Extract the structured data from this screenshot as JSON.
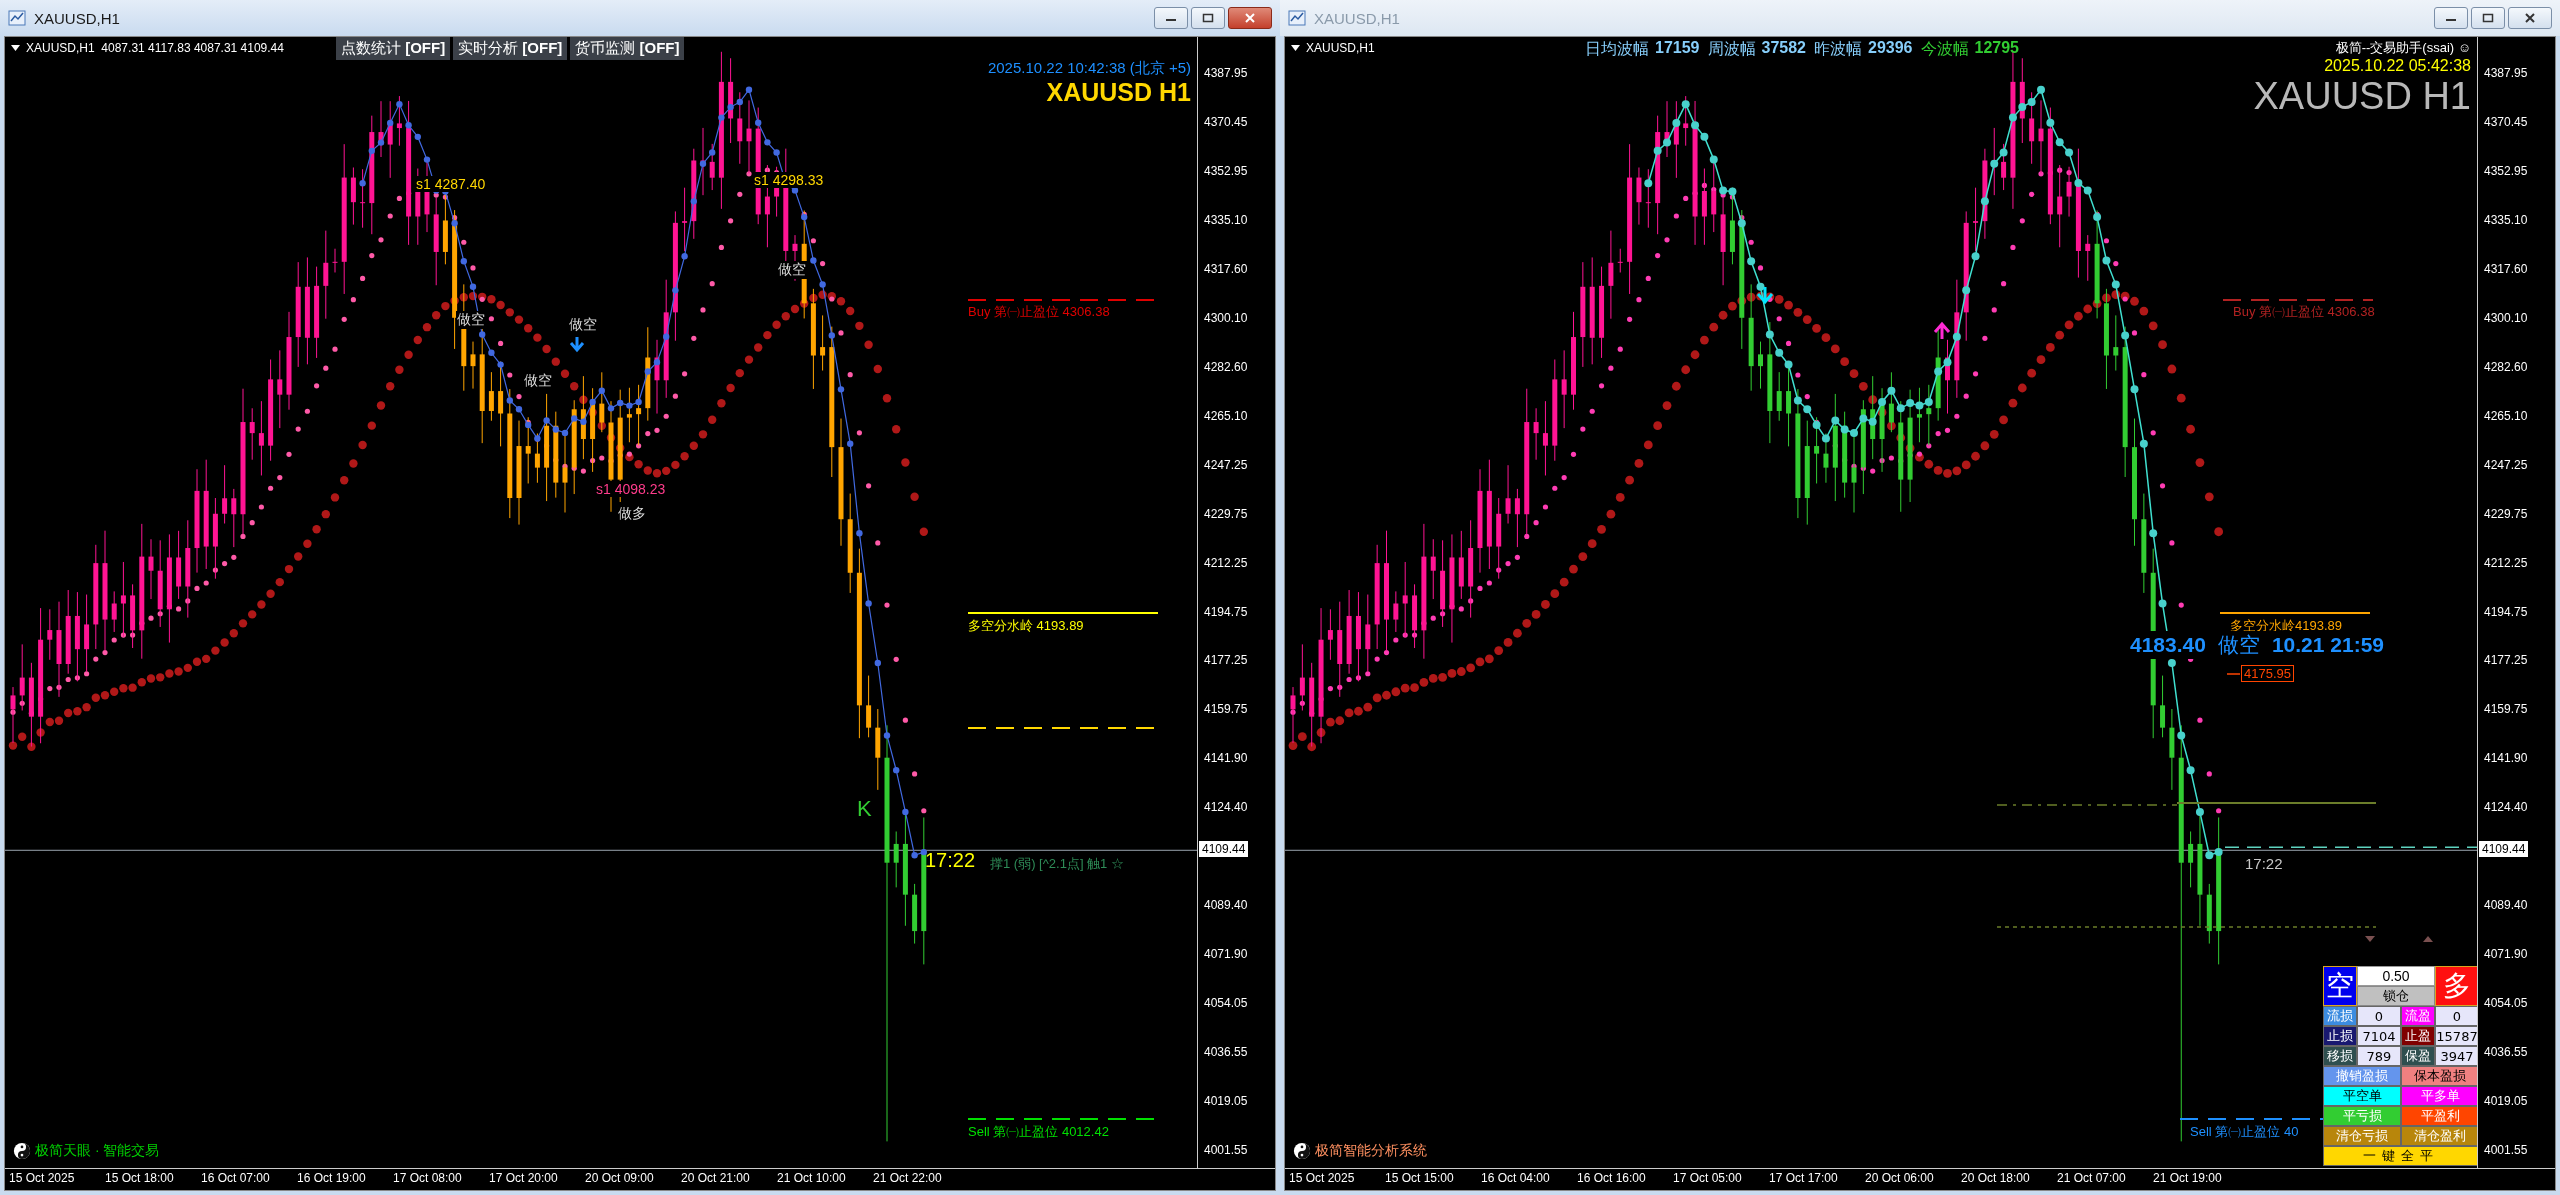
{
  "left_chart": {
    "title": "XAUUSD,H1",
    "active": true,
    "header": "XAUUSD,H1  4087.31 4117.83 4087.31 4109.44",
    "toggles": [
      {
        "label": "点数统计",
        "state": "[OFF]"
      },
      {
        "label": "实时分析",
        "state": "[OFF]"
      },
      {
        "label": "货币监测",
        "state": "[OFF]"
      }
    ],
    "datetime": "2025.10.22 10:42:38 (北京 +5)",
    "symbol": "XAUUSD H1",
    "annotations": [
      {
        "text": "s1 4287.40",
        "color": "#ffd700"
      },
      {
        "text": "s1 4298.33",
        "color": "#ffd700"
      },
      {
        "text": "做空",
        "color": "#dcdcdc"
      },
      {
        "text": "做空",
        "color": "#dcdcdc"
      },
      {
        "text": "做空",
        "color": "#dcdcdc"
      },
      {
        "text": "做空",
        "color": "#dcdcdc"
      },
      {
        "text": "s1 4098.23",
        "color": "#ff3c8c"
      },
      {
        "text": "做多",
        "color": "#dcdcdc"
      },
      {
        "text": "K",
        "color": "#32cd32"
      }
    ],
    "levels": [
      {
        "text": "Buy 第㈠止盈位 4306.38",
        "color": "#e00000"
      },
      {
        "text": "多空分水岭 4193.89",
        "color": "#ffff00"
      },
      {
        "text": "Sell 第㈠止盈位 4012.42",
        "color": "#00e000"
      }
    ],
    "countdown": "17:22",
    "signal": "撑1 (弱) [^2.1点] 触1 ☆",
    "brand": "极简天眼 · 智能交易",
    "current_price": "4109.44",
    "price_labels": [
      "4387.95",
      "4370.45",
      "4352.95",
      "4335.10",
      "4317.60",
      "4300.10",
      "4282.60",
      "4265.10",
      "4247.25",
      "4229.75",
      "4212.25",
      "4194.75",
      "4177.25",
      "4159.75",
      "4141.90",
      "4124.40",
      "4089.40",
      "4071.90",
      "4054.05",
      "4036.55",
      "4019.05",
      "4001.55"
    ],
    "time_labels": [
      "15 Oct 2025",
      "15 Oct 18:00",
      "16 Oct 07:00",
      "16 Oct 19:00",
      "17 Oct 08:00",
      "17 Oct 20:00",
      "20 Oct 09:00",
      "20 Oct 21:00",
      "21 Oct 10:00",
      "21 Oct 22:00"
    ]
  },
  "right_chart": {
    "title": "XAUUSD,H1",
    "active": false,
    "header": "XAUUSD,H1",
    "stats": [
      {
        "label": "日均波幅",
        "value": "17159",
        "color": "#87cefa"
      },
      {
        "label": "周波幅",
        "value": "37582",
        "color": "#87cefa"
      },
      {
        "label": "昨波幅",
        "value": "29396",
        "color": "#87cefa"
      },
      {
        "label": "今波幅",
        "value": "12795",
        "color": "#32cd32"
      }
    ],
    "assistant": "极简--交易助手(ssai) ☺",
    "datetime": "2025.10.22 05:42:38",
    "symbol": "XAUUSD H1",
    "levels": [
      {
        "text": "Buy 第㈠止盈位 4306.38",
        "color": "#b22222"
      },
      {
        "text": "多空分水岭4193.89",
        "color": "#ffa500"
      },
      {
        "text": "Sell 第㈠止盈位 40",
        "color": "#1e90ff"
      }
    ],
    "signal": {
      "price": "4183.40",
      "direction": "做空",
      "time": "10.21 21:59"
    },
    "stop_price": "4175.95",
    "countdown": "17:22",
    "brand": "极简智能分析系统",
    "current_price": "4109.44",
    "trade_panel": {
      "sell": "空",
      "lot": "0.50",
      "lock": "锁仓",
      "buy": "多",
      "cells": [
        {
          "text": "流损",
          "color": "#3c8ce0"
        },
        {
          "text": "0"
        },
        {
          "text": "流盈",
          "color": "#ff00ff"
        },
        {
          "text": "0"
        },
        {
          "text": "止损",
          "color": "#191970"
        },
        {
          "text": "7104"
        },
        {
          "text": "止盈",
          "color": "#800000"
        },
        {
          "text": "15787"
        },
        {
          "text": "移损",
          "color": "#2f4f4f"
        },
        {
          "text": "789"
        },
        {
          "text": "保盈",
          "color": "#2f4f4f"
        },
        {
          "text": "3947"
        }
      ],
      "buttons": [
        {
          "label": "撤销盈损",
          "color": "#6495ed"
        },
        {
          "label": "保本盈损",
          "color": "#f08080"
        },
        {
          "label": "平空单",
          "color": "#00ffff"
        },
        {
          "label": "平多单",
          "color": "#ff00ff"
        },
        {
          "label": "平亏损",
          "color": "#32cd32"
        },
        {
          "label": "平盈利",
          "color": "#ff4500"
        },
        {
          "label": "清仓亏损",
          "color": "#b8860b"
        },
        {
          "label": "清仓盈利",
          "color": "#b8860b"
        },
        {
          "label": "一键全平",
          "color": "#ffd700"
        }
      ]
    },
    "price_labels": [
      "4387.95",
      "4370.45",
      "4352.95",
      "4335.10",
      "4317.60",
      "4300.10",
      "4282.60",
      "4265.10",
      "4247.25",
      "4229.75",
      "4212.25",
      "4194.75",
      "4177.25",
      "4159.75",
      "4141.90",
      "4124.40",
      "4089.40",
      "4071.90",
      "4054.05",
      "4036.55",
      "4019.05",
      "4001.55"
    ],
    "time_labels": [
      "15 Oct 2025",
      "15 Oct 15:00",
      "16 Oct 04:00",
      "16 Oct 16:00",
      "17 Oct 05:00",
      "17 Oct 17:00",
      "20 Oct 06:00",
      "20 Oct 18:00",
      "21 Oct 07:00",
      "21 Oct 19:00"
    ]
  }
}
